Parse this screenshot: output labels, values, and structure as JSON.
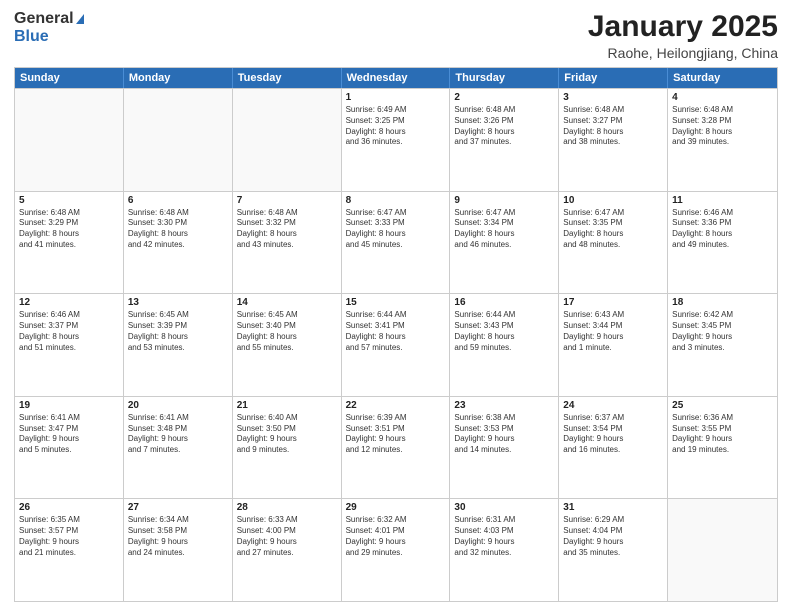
{
  "logo": {
    "general": "General",
    "blue": "Blue"
  },
  "title": {
    "month": "January 2025",
    "location": "Raohe, Heilongjiang, China"
  },
  "weekdays": [
    "Sunday",
    "Monday",
    "Tuesday",
    "Wednesday",
    "Thursday",
    "Friday",
    "Saturday"
  ],
  "weeks": [
    [
      {
        "day": "",
        "info": ""
      },
      {
        "day": "",
        "info": ""
      },
      {
        "day": "",
        "info": ""
      },
      {
        "day": "1",
        "info": "Sunrise: 6:49 AM\nSunset: 3:25 PM\nDaylight: 8 hours\nand 36 minutes."
      },
      {
        "day": "2",
        "info": "Sunrise: 6:48 AM\nSunset: 3:26 PM\nDaylight: 8 hours\nand 37 minutes."
      },
      {
        "day": "3",
        "info": "Sunrise: 6:48 AM\nSunset: 3:27 PM\nDaylight: 8 hours\nand 38 minutes."
      },
      {
        "day": "4",
        "info": "Sunrise: 6:48 AM\nSunset: 3:28 PM\nDaylight: 8 hours\nand 39 minutes."
      }
    ],
    [
      {
        "day": "5",
        "info": "Sunrise: 6:48 AM\nSunset: 3:29 PM\nDaylight: 8 hours\nand 41 minutes."
      },
      {
        "day": "6",
        "info": "Sunrise: 6:48 AM\nSunset: 3:30 PM\nDaylight: 8 hours\nand 42 minutes."
      },
      {
        "day": "7",
        "info": "Sunrise: 6:48 AM\nSunset: 3:32 PM\nDaylight: 8 hours\nand 43 minutes."
      },
      {
        "day": "8",
        "info": "Sunrise: 6:47 AM\nSunset: 3:33 PM\nDaylight: 8 hours\nand 45 minutes."
      },
      {
        "day": "9",
        "info": "Sunrise: 6:47 AM\nSunset: 3:34 PM\nDaylight: 8 hours\nand 46 minutes."
      },
      {
        "day": "10",
        "info": "Sunrise: 6:47 AM\nSunset: 3:35 PM\nDaylight: 8 hours\nand 48 minutes."
      },
      {
        "day": "11",
        "info": "Sunrise: 6:46 AM\nSunset: 3:36 PM\nDaylight: 8 hours\nand 49 minutes."
      }
    ],
    [
      {
        "day": "12",
        "info": "Sunrise: 6:46 AM\nSunset: 3:37 PM\nDaylight: 8 hours\nand 51 minutes."
      },
      {
        "day": "13",
        "info": "Sunrise: 6:45 AM\nSunset: 3:39 PM\nDaylight: 8 hours\nand 53 minutes."
      },
      {
        "day": "14",
        "info": "Sunrise: 6:45 AM\nSunset: 3:40 PM\nDaylight: 8 hours\nand 55 minutes."
      },
      {
        "day": "15",
        "info": "Sunrise: 6:44 AM\nSunset: 3:41 PM\nDaylight: 8 hours\nand 57 minutes."
      },
      {
        "day": "16",
        "info": "Sunrise: 6:44 AM\nSunset: 3:43 PM\nDaylight: 8 hours\nand 59 minutes."
      },
      {
        "day": "17",
        "info": "Sunrise: 6:43 AM\nSunset: 3:44 PM\nDaylight: 9 hours\nand 1 minute."
      },
      {
        "day": "18",
        "info": "Sunrise: 6:42 AM\nSunset: 3:45 PM\nDaylight: 9 hours\nand 3 minutes."
      }
    ],
    [
      {
        "day": "19",
        "info": "Sunrise: 6:41 AM\nSunset: 3:47 PM\nDaylight: 9 hours\nand 5 minutes."
      },
      {
        "day": "20",
        "info": "Sunrise: 6:41 AM\nSunset: 3:48 PM\nDaylight: 9 hours\nand 7 minutes."
      },
      {
        "day": "21",
        "info": "Sunrise: 6:40 AM\nSunset: 3:50 PM\nDaylight: 9 hours\nand 9 minutes."
      },
      {
        "day": "22",
        "info": "Sunrise: 6:39 AM\nSunset: 3:51 PM\nDaylight: 9 hours\nand 12 minutes."
      },
      {
        "day": "23",
        "info": "Sunrise: 6:38 AM\nSunset: 3:53 PM\nDaylight: 9 hours\nand 14 minutes."
      },
      {
        "day": "24",
        "info": "Sunrise: 6:37 AM\nSunset: 3:54 PM\nDaylight: 9 hours\nand 16 minutes."
      },
      {
        "day": "25",
        "info": "Sunrise: 6:36 AM\nSunset: 3:55 PM\nDaylight: 9 hours\nand 19 minutes."
      }
    ],
    [
      {
        "day": "26",
        "info": "Sunrise: 6:35 AM\nSunset: 3:57 PM\nDaylight: 9 hours\nand 21 minutes."
      },
      {
        "day": "27",
        "info": "Sunrise: 6:34 AM\nSunset: 3:58 PM\nDaylight: 9 hours\nand 24 minutes."
      },
      {
        "day": "28",
        "info": "Sunrise: 6:33 AM\nSunset: 4:00 PM\nDaylight: 9 hours\nand 27 minutes."
      },
      {
        "day": "29",
        "info": "Sunrise: 6:32 AM\nSunset: 4:01 PM\nDaylight: 9 hours\nand 29 minutes."
      },
      {
        "day": "30",
        "info": "Sunrise: 6:31 AM\nSunset: 4:03 PM\nDaylight: 9 hours\nand 32 minutes."
      },
      {
        "day": "31",
        "info": "Sunrise: 6:29 AM\nSunset: 4:04 PM\nDaylight: 9 hours\nand 35 minutes."
      },
      {
        "day": "",
        "info": ""
      }
    ]
  ]
}
